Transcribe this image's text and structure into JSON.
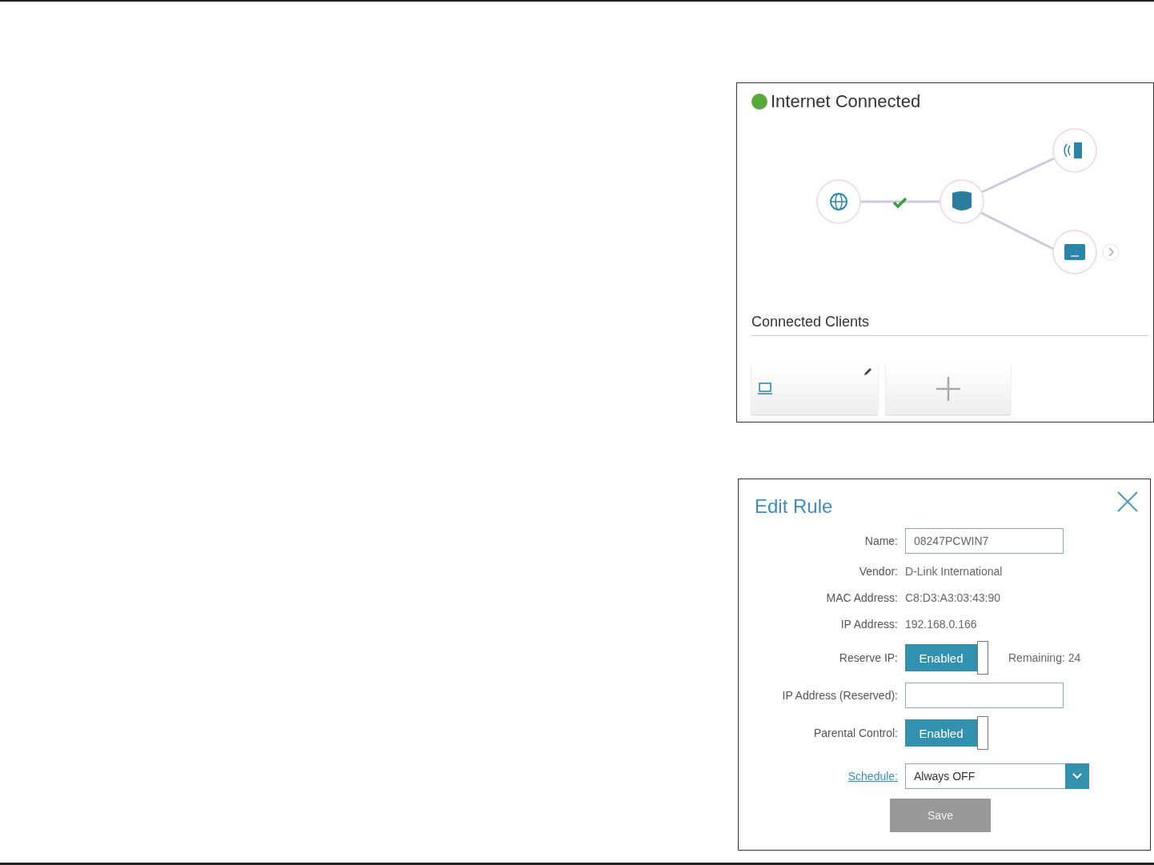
{
  "network_map": {
    "status": {
      "title": "Internet Connected",
      "connected": true
    },
    "clients_section": {
      "title": "Connected Clients"
    }
  },
  "edit_rule": {
    "title": "Edit Rule",
    "fields": [
      {
        "kind": "input",
        "label": "Name:",
        "value": "08247PCWIN7"
      },
      {
        "kind": "text",
        "label": "Vendor:",
        "value": "D-Link International"
      },
      {
        "kind": "text",
        "label": "MAC Address:",
        "value": "C8:D3:A3:03:43:90"
      },
      {
        "kind": "text",
        "label": "IP Address:",
        "value": "192.168.0.166"
      },
      {
        "kind": "toggle",
        "label": "Reserve IP:",
        "value": "Enabled",
        "on": true,
        "note": "Remaining: 24"
      },
      {
        "kind": "input",
        "label": "IP Address (Reserved):"
      },
      {
        "kind": "toggle",
        "label": "Parental Control:",
        "value": "Enabled",
        "on": true
      },
      {
        "kind": "select",
        "label": "Schedule:",
        "link": true,
        "value": "Always OFF"
      }
    ],
    "save": {
      "label": "Save",
      "disabled": true
    }
  }
}
